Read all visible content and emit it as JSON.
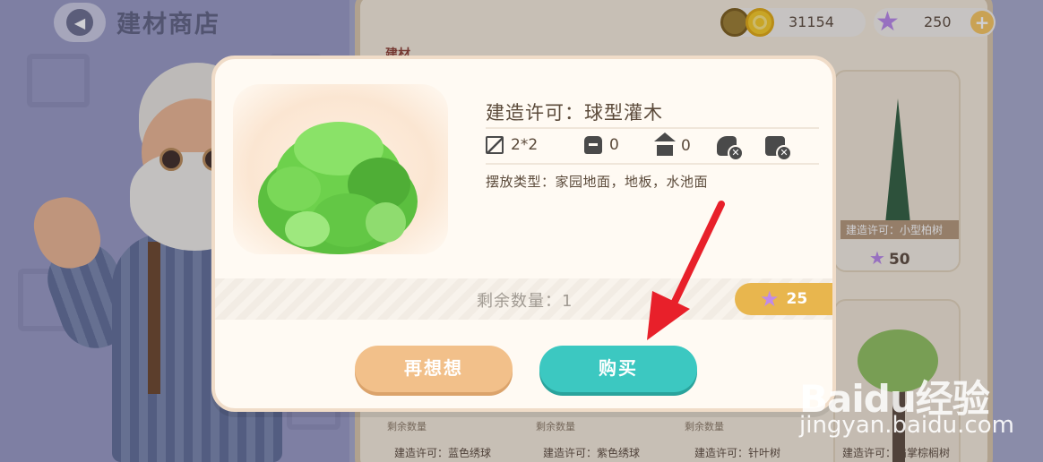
{
  "header": {
    "back_label": "",
    "shop_title": "建材商店"
  },
  "currency": {
    "coins": "31154",
    "stars": "250",
    "add_symbol": "+"
  },
  "background": {
    "section_tag": "建材",
    "cards": [
      {
        "label": "建造许可：小型柏树",
        "price": "50"
      }
    ],
    "bottom_labels": [
      "建造许可：蓝色绣球",
      "建造许可：紫色绣球",
      "建造许可：针叶树",
      "建造许可：扇掌棕榈树"
    ],
    "remaining_label": "剩余数量"
  },
  "modal": {
    "title": "建造许可：球型灌木",
    "stats": {
      "size": "2*2",
      "bag_count": "0",
      "home_count": "0"
    },
    "placement": "摆放类型：家园地面，地板，水池面",
    "remaining": "剩余数量：1",
    "price": "25",
    "cancel_label": "再想想",
    "buy_label": "购买"
  },
  "watermark": {
    "logo": "Baidu经验",
    "sub": "jingyan.baidu.com"
  },
  "colors": {
    "buy": "#3cc8c1",
    "cancel": "#f2c08a",
    "price_pill": "#e8b64e",
    "star": "#b784e6",
    "annotation_arrow": "#e8202a"
  },
  "icons": [
    "back-arrow-icon",
    "coin-icon",
    "star-icon",
    "plus-icon",
    "size-icon",
    "bag-icon",
    "home-icon",
    "no-rotate-icon",
    "no-place-icon"
  ]
}
